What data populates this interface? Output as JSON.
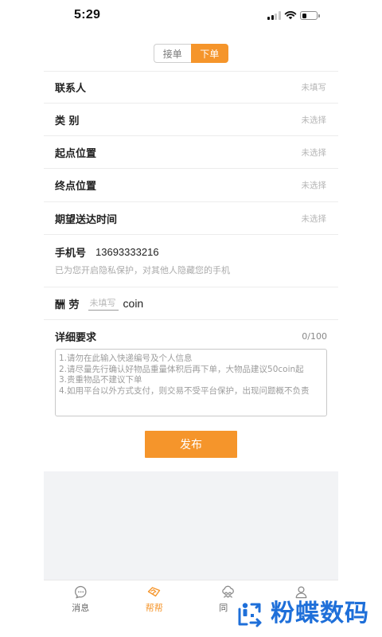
{
  "colors": {
    "accent": "#f5952b",
    "panel_background": "#f2f3f5",
    "watermark": "#1e6fd9",
    "divider": "#ececec"
  },
  "status_bar": {
    "time": "5:29",
    "signal_bars": 2,
    "signal_bars_max": 4,
    "battery_level": 0.35
  },
  "segmented": {
    "options": [
      {
        "label": "接单",
        "selected": false
      },
      {
        "label": "下单",
        "selected": true
      }
    ]
  },
  "form": {
    "rows": [
      {
        "label": "联系人",
        "value": "未填写"
      },
      {
        "label": "类 别",
        "value": "未选择"
      },
      {
        "label": "起点位置",
        "value": "未选择"
      },
      {
        "label": "终点位置",
        "value": "未选择"
      },
      {
        "label": "期望送达时间",
        "value": "未选择"
      }
    ],
    "phone": {
      "label": "手机号",
      "value": "13693333216",
      "note": "已为您开启隐私保护，对其他人隐藏您的手机"
    },
    "reward": {
      "label": "酬 劳",
      "placeholder": "未填写",
      "unit": "coin"
    },
    "details": {
      "label": "详细要求",
      "counter": "0/100",
      "placeholder": "1.请勿在此输入快递编号及个人信息\n2.请尽量先行确认好物品重量体积后再下单，大物品建议50coin起\n3.贵重物品不建议下单\n4.如用平台以外方式支付，则交易不受平台保护，出现问题概不负责"
    }
  },
  "submit": {
    "label": "发布"
  },
  "tabbar": {
    "items": [
      {
        "label": "消息",
        "icon": "chat-bubble-icon",
        "active": false
      },
      {
        "label": "帮帮",
        "icon": "help-handshake-icon",
        "active": true
      },
      {
        "label": "同",
        "icon": "cloud-group-icon",
        "active": false
      },
      {
        "icon": "person-icon",
        "active": false
      }
    ]
  },
  "watermark": {
    "text": "粉蝶数码",
    "icon": "butterfly-logo-icon"
  }
}
